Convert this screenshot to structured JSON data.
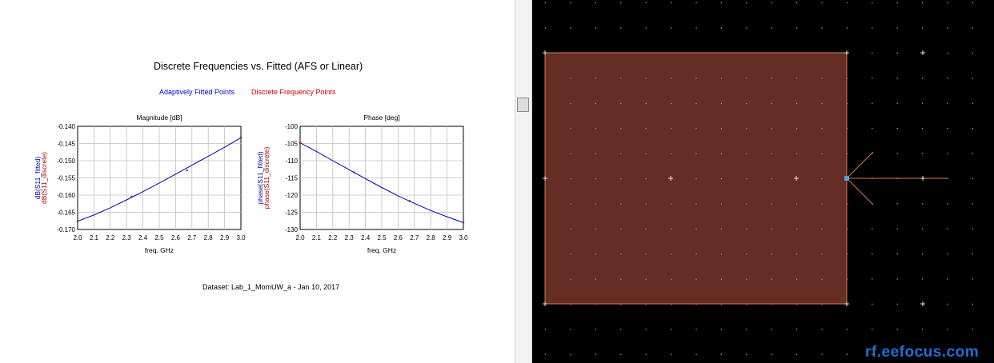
{
  "data_display": {
    "title": "Discrete Frequencies vs. Fitted (AFS or Linear)",
    "legend": [
      {
        "label": "Adaptively Fitted Points",
        "color": "#0000cc"
      },
      {
        "label": "Discrete Frequency Points",
        "color": "#cc0000"
      }
    ],
    "dataset_label": "Dataset: Lab_1_MomUW_a - Jan 10, 2017"
  },
  "chart_data": [
    {
      "type": "line",
      "title": "Magnitude [dB]",
      "xlabel": "freq, GHz",
      "ylabel_fitted": "dB(S11_fitted)",
      "ylabel_discrete": "dB(S11_discrete)",
      "xlim": [
        2.0,
        3.0
      ],
      "ylim": [
        -0.17,
        -0.14
      ],
      "xticks": [
        "2.0",
        "2.1",
        "2.2",
        "2.3",
        "2.4",
        "2.5",
        "2.6",
        "2.7",
        "2.8",
        "2.9",
        "3.0"
      ],
      "yticks": [
        "-0.140",
        "-0.145",
        "-0.150",
        "-0.155",
        "-0.160",
        "-0.165",
        "-0.170"
      ],
      "grid": true,
      "series": [
        {
          "name": "dB(S11_fitted)",
          "color": "#0000aa",
          "x": [
            2.0,
            2.1,
            2.2,
            2.3,
            2.4,
            2.5,
            2.6,
            2.7,
            2.8,
            2.9,
            3.0
          ],
          "values": [
            -0.1676,
            -0.1658,
            -0.1637,
            -0.1614,
            -0.159,
            -0.1565,
            -0.1539,
            -0.1513,
            -0.1487,
            -0.1461,
            -0.1433
          ]
        },
        {
          "name": "dB(S11_discrete)",
          "color": "#aa0000",
          "x": [
            2.0,
            2.33,
            2.67,
            3.0
          ],
          "values": [
            -0.1676,
            -0.1605,
            -0.1528,
            -0.1433
          ]
        }
      ]
    },
    {
      "type": "line",
      "title": "Phase [deg]",
      "xlabel": "freq, GHz",
      "ylabel_fitted": "phase(S11_fitted)",
      "ylabel_discrete": "phase(S11_discrete)",
      "xlim": [
        2.0,
        3.0
      ],
      "ylim": [
        -130,
        -100
      ],
      "xticks": [
        "2.0",
        "2.1",
        "2.2",
        "2.3",
        "2.4",
        "2.5",
        "2.6",
        "2.7",
        "2.8",
        "2.9",
        "3.0"
      ],
      "yticks": [
        "-100",
        "-105",
        "-110",
        "-115",
        "-120",
        "-125",
        "-130"
      ],
      "grid": true,
      "series": [
        {
          "name": "phase(S11_fitted)",
          "color": "#0000aa",
          "x": [
            2.0,
            2.1,
            2.2,
            2.3,
            2.4,
            2.5,
            2.6,
            2.7,
            2.8,
            2.9,
            3.0
          ],
          "values": [
            -104.8,
            -107.3,
            -110.0,
            -112.6,
            -115.2,
            -117.8,
            -120.2,
            -122.4,
            -124.5,
            -126.3,
            -128.0
          ]
        },
        {
          "name": "phase(S11_discrete)",
          "color": "#aa0000",
          "x": [
            2.0,
            2.33,
            2.67,
            3.0
          ],
          "values": [
            -104.8,
            -113.4,
            -121.7,
            -128.0
          ]
        }
      ]
    }
  ],
  "layout_view": {
    "background": "#000000",
    "patch_fill": "#662d24",
    "patch_stroke": "#d87a55",
    "pin_color": "#4fa3e0",
    "watermark": "rf.eefocus.com",
    "watermark_color": "#1e6fd6"
  }
}
